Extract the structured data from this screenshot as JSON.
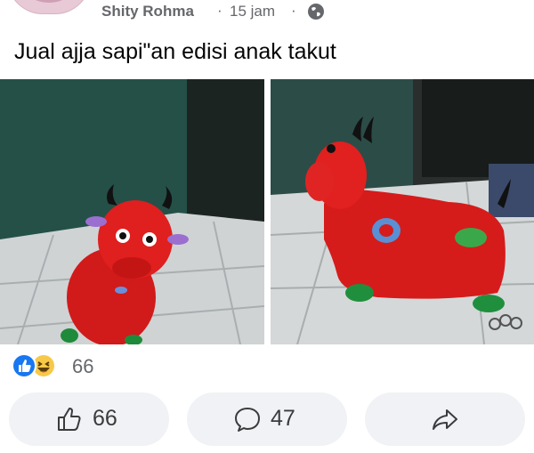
{
  "post": {
    "author": "Shity Rohma",
    "separator": "·",
    "time": "15 jam",
    "caption": "Jual ajja sapi\"an edisi anak takut"
  },
  "reactions": {
    "count": "66",
    "types": [
      "like-icon",
      "haha-icon"
    ]
  },
  "actions": {
    "like_count": "66",
    "comment_count": "47"
  },
  "colors": {
    "like_blue": "#1877f2",
    "button_bg": "#f0f2f5",
    "meta_gray": "#65676b"
  }
}
